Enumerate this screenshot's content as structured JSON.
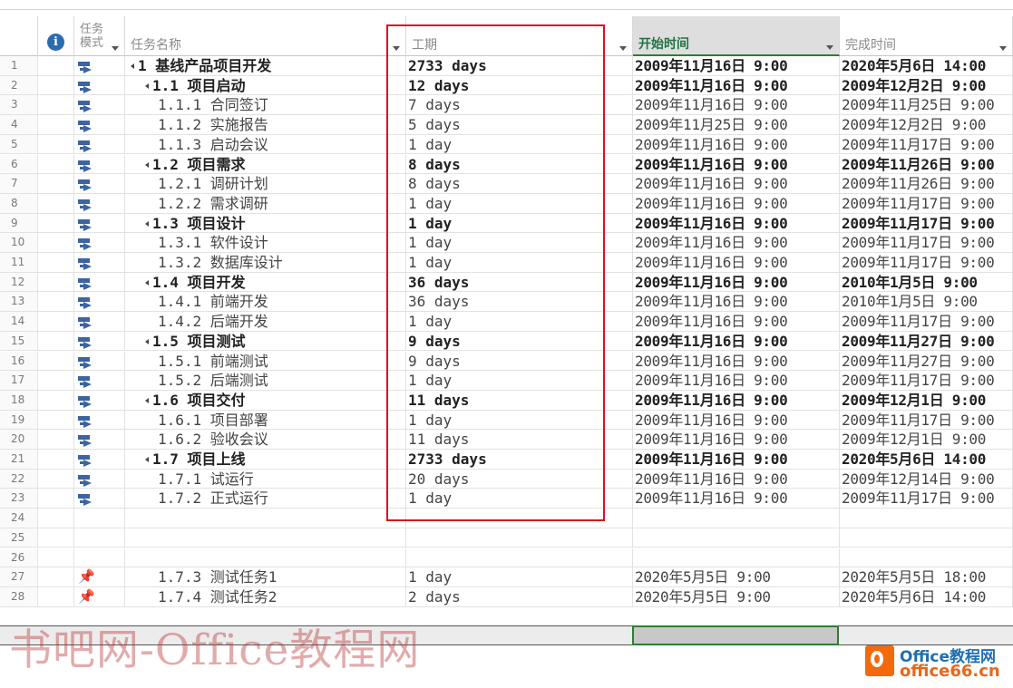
{
  "columns": {
    "mode_line1": "任务",
    "mode_line2": "模式",
    "name": "任务名称",
    "duration": "工期",
    "start": "开始时间",
    "finish": "完成时间"
  },
  "icons": {
    "info": "i",
    "manual_pin": "📌"
  },
  "rows": [
    {
      "num": "1",
      "mode": "auto",
      "outline": true,
      "indent": 0,
      "name": "1 基线产品项目开发",
      "duration": "2733 days",
      "start": "2009年11月16日 9:00",
      "finish": "2020年5月6日 14:00",
      "bold": true
    },
    {
      "num": "2",
      "mode": "auto",
      "outline": true,
      "indent": 1,
      "name": "1.1 项目启动",
      "duration": "12 days",
      "start": "2009年11月16日 9:00",
      "finish": "2009年12月2日 9:00",
      "bold": true
    },
    {
      "num": "3",
      "mode": "auto",
      "outline": false,
      "indent": 2,
      "name": "1.1.1 合同签订",
      "duration": "7 days",
      "start": "2009年11月16日 9:00",
      "finish": "2009年11月25日 9:00",
      "bold": false
    },
    {
      "num": "4",
      "mode": "auto",
      "outline": false,
      "indent": 2,
      "name": "1.1.2 实施报告",
      "duration": "5 days",
      "start": "2009年11月25日 9:00",
      "finish": "2009年12月2日 9:00",
      "bold": false
    },
    {
      "num": "5",
      "mode": "auto",
      "outline": false,
      "indent": 2,
      "name": "1.1.3 启动会议",
      "duration": "1 day",
      "start": "2009年11月16日 9:00",
      "finish": "2009年11月17日 9:00",
      "bold": false
    },
    {
      "num": "6",
      "mode": "auto",
      "outline": true,
      "indent": 1,
      "name": "1.2 项目需求",
      "duration": "8 days",
      "start": "2009年11月16日 9:00",
      "finish": "2009年11月26日 9:00",
      "bold": true
    },
    {
      "num": "7",
      "mode": "auto",
      "outline": false,
      "indent": 2,
      "name": "1.2.1 调研计划",
      "duration": "8 days",
      "start": "2009年11月16日 9:00",
      "finish": "2009年11月26日 9:00",
      "bold": false
    },
    {
      "num": "8",
      "mode": "auto",
      "outline": false,
      "indent": 2,
      "name": "1.2.2 需求调研",
      "duration": "1 day",
      "start": "2009年11月16日 9:00",
      "finish": "2009年11月17日 9:00",
      "bold": false
    },
    {
      "num": "9",
      "mode": "auto",
      "outline": true,
      "indent": 1,
      "name": "1.3 项目设计",
      "duration": "1 day",
      "start": "2009年11月16日 9:00",
      "finish": "2009年11月17日 9:00",
      "bold": true
    },
    {
      "num": "10",
      "mode": "auto",
      "outline": false,
      "indent": 2,
      "name": "1.3.1 软件设计",
      "duration": "1 day",
      "start": "2009年11月16日 9:00",
      "finish": "2009年11月17日 9:00",
      "bold": false
    },
    {
      "num": "11",
      "mode": "auto",
      "outline": false,
      "indent": 2,
      "name": "1.3.2 数据库设计",
      "duration": "1 day",
      "start": "2009年11月16日 9:00",
      "finish": "2009年11月17日 9:00",
      "bold": false
    },
    {
      "num": "12",
      "mode": "auto",
      "outline": true,
      "indent": 1,
      "name": "1.4 项目开发",
      "duration": "36 days",
      "start": "2009年11月16日 9:00",
      "finish": "2010年1月5日 9:00",
      "bold": true
    },
    {
      "num": "13",
      "mode": "auto",
      "outline": false,
      "indent": 2,
      "name": "1.4.1 前端开发",
      "duration": "36 days",
      "start": "2009年11月16日 9:00",
      "finish": "2010年1月5日 9:00",
      "bold": false
    },
    {
      "num": "14",
      "mode": "auto",
      "outline": false,
      "indent": 2,
      "name": "1.4.2 后端开发",
      "duration": "1 day",
      "start": "2009年11月16日 9:00",
      "finish": "2009年11月17日 9:00",
      "bold": false
    },
    {
      "num": "15",
      "mode": "auto",
      "outline": true,
      "indent": 1,
      "name": "1.5 项目测试",
      "duration": "9 days",
      "start": "2009年11月16日 9:00",
      "finish": "2009年11月27日 9:00",
      "bold": true
    },
    {
      "num": "16",
      "mode": "auto",
      "outline": false,
      "indent": 2,
      "name": "1.5.1 前端测试",
      "duration": "9 days",
      "start": "2009年11月16日 9:00",
      "finish": "2009年11月27日 9:00",
      "bold": false
    },
    {
      "num": "17",
      "mode": "auto",
      "outline": false,
      "indent": 2,
      "name": "1.5.2 后端测试",
      "duration": "1 day",
      "start": "2009年11月16日 9:00",
      "finish": "2009年11月17日 9:00",
      "bold": false
    },
    {
      "num": "18",
      "mode": "auto",
      "outline": true,
      "indent": 1,
      "name": "1.6 项目交付",
      "duration": "11 days",
      "start": "2009年11月16日 9:00",
      "finish": "2009年12月1日 9:00",
      "bold": true
    },
    {
      "num": "19",
      "mode": "auto",
      "outline": false,
      "indent": 2,
      "name": "1.6.1 项目部署",
      "duration": "1 day",
      "start": "2009年11月16日 9:00",
      "finish": "2009年11月17日 9:00",
      "bold": false
    },
    {
      "num": "20",
      "mode": "auto",
      "outline": false,
      "indent": 2,
      "name": "1.6.2 验收会议",
      "duration": "11 days",
      "start": "2009年11月16日 9:00",
      "finish": "2009年12月1日 9:00",
      "bold": false
    },
    {
      "num": "21",
      "mode": "auto",
      "outline": true,
      "indent": 1,
      "name": "1.7 项目上线",
      "duration": "2733 days",
      "start": "2009年11月16日 9:00",
      "finish": "2020年5月6日 14:00",
      "bold": true
    },
    {
      "num": "22",
      "mode": "auto",
      "outline": false,
      "indent": 2,
      "name": "1.7.1 试运行",
      "duration": "20 days",
      "start": "2009年11月16日 9:00",
      "finish": "2009年12月14日 9:00",
      "bold": false
    },
    {
      "num": "23",
      "mode": "auto",
      "outline": false,
      "indent": 2,
      "name": "1.7.2 正式运行",
      "duration": "1 day",
      "start": "2009年11月16日 9:00",
      "finish": "2009年11月17日 9:00",
      "bold": false
    },
    {
      "num": "24",
      "mode": "",
      "outline": false,
      "indent": 0,
      "name": "",
      "duration": "",
      "start": "",
      "finish": "",
      "bold": false
    },
    {
      "num": "25",
      "mode": "",
      "outline": false,
      "indent": 0,
      "name": "",
      "duration": "",
      "start": "",
      "finish": "",
      "bold": false
    },
    {
      "num": "26",
      "mode": "",
      "outline": false,
      "indent": 0,
      "name": "",
      "duration": "",
      "start": "",
      "finish": "",
      "bold": false
    },
    {
      "num": "27",
      "mode": "manual",
      "outline": false,
      "indent": 2,
      "name": "1.7.3 测试任务1",
      "duration": "1 day",
      "start": "2020年5月5日 9:00",
      "finish": "2020年5月5日 18:00",
      "bold": false
    },
    {
      "num": "28",
      "mode": "manual",
      "outline": false,
      "indent": 2,
      "name": "1.7.4 测试任务2",
      "duration": "2 days",
      "start": "2020年5月5日 9:00",
      "finish": "2020年5月6日 14:00",
      "bold": false
    }
  ],
  "watermark": "书吧网-Office教程网",
  "logo": {
    "line1": "Office教程网",
    "line2": "office66.cn"
  }
}
